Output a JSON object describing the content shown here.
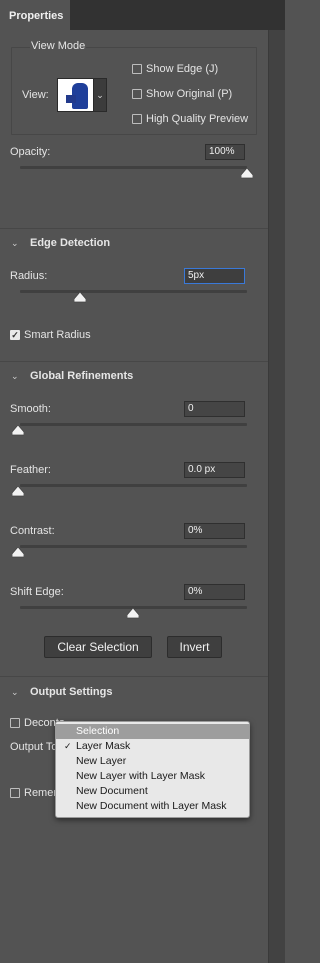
{
  "panel": {
    "tab_title": "Properties"
  },
  "view_mode": {
    "title": "View Mode",
    "view_label": "View:",
    "thumbnail_icon": "portrait-thumbnail",
    "show_edge": {
      "label": "Show Edge (J)",
      "checked": false
    },
    "show_original": {
      "label": "Show Original (P)",
      "checked": false
    },
    "high_quality": {
      "label": "High Quality Preview",
      "checked": false
    }
  },
  "opacity": {
    "label": "Opacity:",
    "value": "100%",
    "level": 1.0
  },
  "edge_detection": {
    "title": "Edge Detection",
    "radius_label": "Radius:",
    "radius_value": "5px",
    "radius_level": 0.25,
    "smart_radius": {
      "label": "Smart Radius",
      "checked": true
    }
  },
  "global_refinements": {
    "title": "Global Refinements",
    "smooth": {
      "label": "Smooth:",
      "value": "0",
      "level": 0
    },
    "feather": {
      "label": "Feather:",
      "value": "0.0 px",
      "level": 0
    },
    "contrast": {
      "label": "Contrast:",
      "value": "0%",
      "level": 0
    },
    "shift_edge": {
      "label": "Shift Edge:",
      "value": "0%",
      "level": 0.5
    },
    "clear_selection_label": "Clear Selection",
    "invert_label": "Invert"
  },
  "output_settings": {
    "title": "Output Settings",
    "decontaminate_label": "Deconta",
    "output_to_label": "Output To",
    "remember_label": "Remem",
    "menu_items": [
      {
        "label": "Selection",
        "highlighted": true,
        "checked": false
      },
      {
        "label": "Layer Mask",
        "highlighted": false,
        "checked": true
      },
      {
        "label": "New Layer",
        "highlighted": false,
        "checked": false
      },
      {
        "label": "New Layer with Layer Mask",
        "highlighted": false,
        "checked": false
      },
      {
        "label": "New Document",
        "highlighted": false,
        "checked": false
      },
      {
        "label": "New Document with Layer Mask",
        "highlighted": false,
        "checked": false
      }
    ]
  },
  "colors": {
    "panel_bg": "#535353",
    "focus_border": "#3a79d8",
    "menu_bg": "#e8e8e8",
    "menu_highlight": "#9d9d9d"
  }
}
